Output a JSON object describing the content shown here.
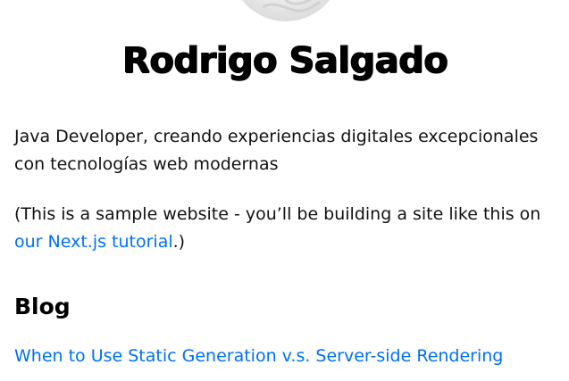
{
  "profile": {
    "name": "Rodrigo Salgado",
    "bio": "Java Developer, creando experiencias digitales excepcionales con tecnologías web modernas"
  },
  "note": {
    "prefix": "(This is a sample website - you’ll be building a site like this on ",
    "link_label": "our Next.js tutorial",
    "suffix": ".)"
  },
  "blog": {
    "heading": "Blog",
    "posts": [
      {
        "title": "When to Use Static Generation v.s. Server-side Rendering"
      }
    ]
  },
  "colors": {
    "link": "#0070f3",
    "text": "#111111",
    "heading": "#000000"
  }
}
